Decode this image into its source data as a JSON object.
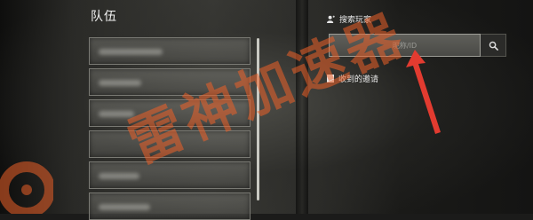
{
  "team": {
    "title": "队伍",
    "slots": [
      {
        "name_visible": false
      },
      {
        "name_visible": false
      },
      {
        "name_visible": false
      },
      {
        "name_visible": false
      },
      {
        "name_visible": false
      },
      {
        "name_visible": false
      }
    ]
  },
  "search": {
    "heading": "搜索玩家",
    "placeholder": "昵称/ID",
    "button_icon": "search-icon"
  },
  "invites": {
    "heading": "收到的邀请"
  },
  "watermark": {
    "text": "雷神加速器"
  },
  "colors": {
    "watermark": "#ec6028",
    "arrow": "#e23b30"
  }
}
